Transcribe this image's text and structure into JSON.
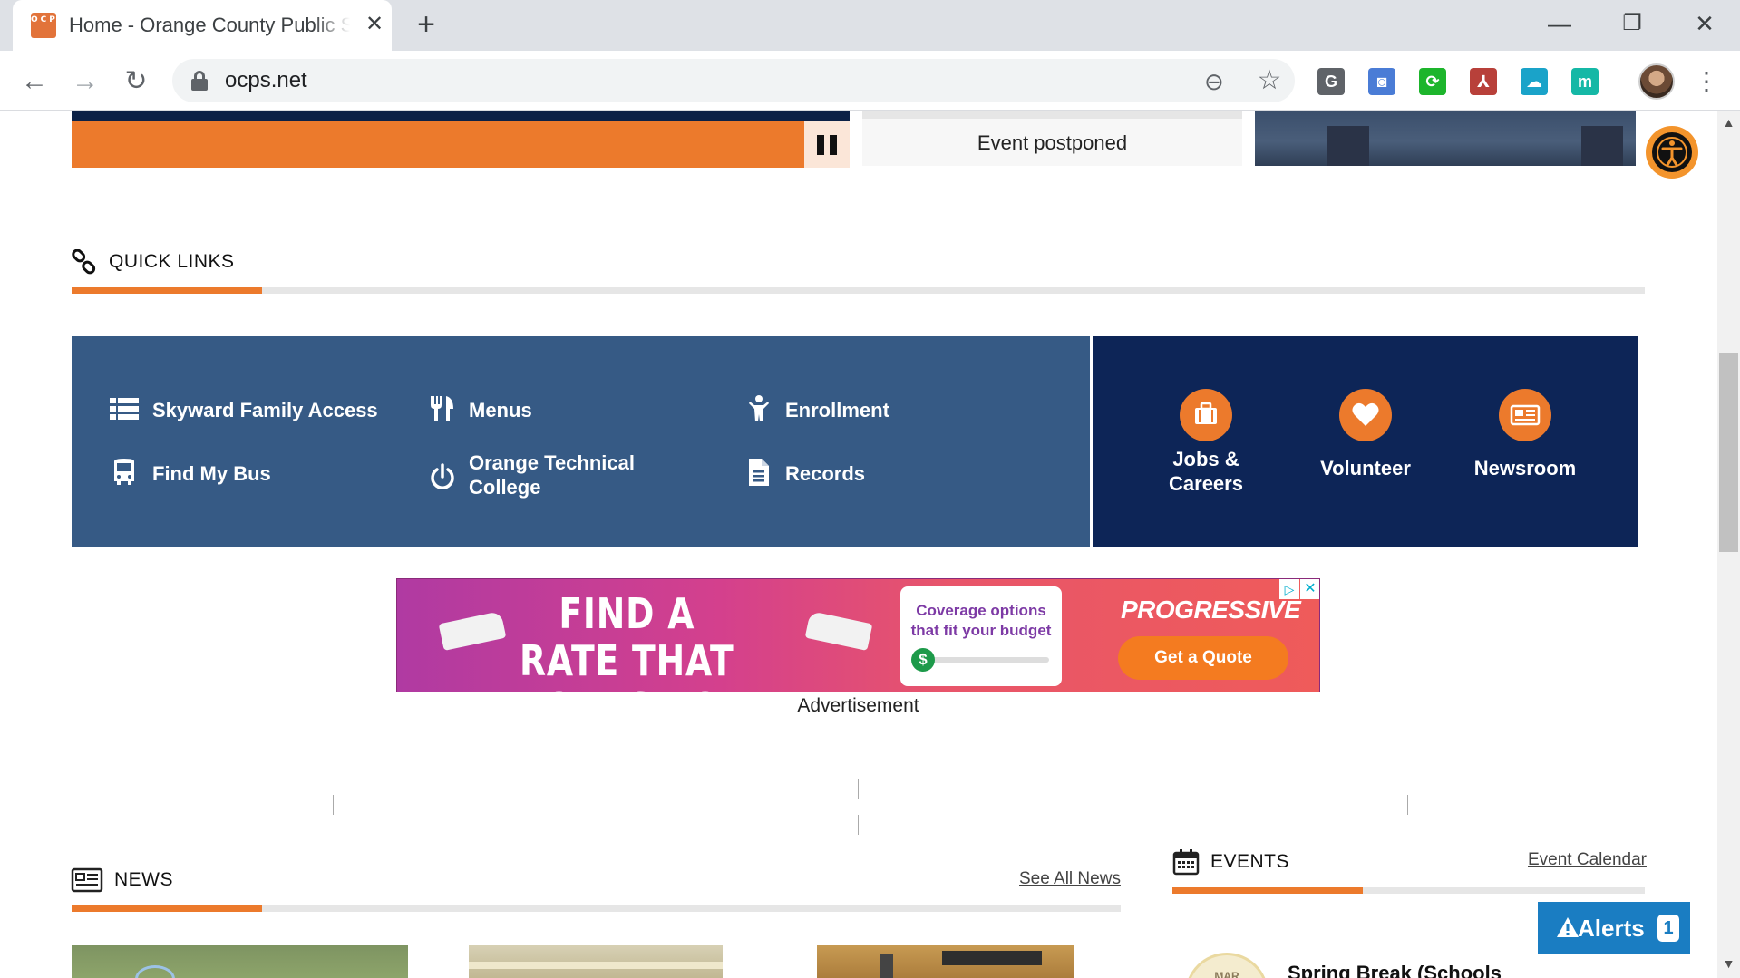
{
  "browser": {
    "tab_title": "Home - Orange County Public Schools",
    "favicon_text": "OCPS",
    "url": "ocps.net",
    "new_tab_symbol": "+",
    "tab_close_symbol": "✕",
    "back_symbol": "←",
    "forward_symbol": "→",
    "reload_symbol": "↻",
    "zoom_symbol": "⊖",
    "star_symbol": "☆",
    "minimize_symbol": "—",
    "restore_symbol": "❐",
    "window_close_symbol": "✕",
    "menu_symbol": "⋮",
    "extensions": [
      {
        "name": "grammarly-extension-icon",
        "glyph": "G",
        "color": "#5f6368"
      },
      {
        "name": "camera-extension-icon",
        "glyph": "◙",
        "color": "#4a7cd6"
      },
      {
        "name": "sync-extension-icon",
        "glyph": "⟳",
        "color": "#1db52c"
      },
      {
        "name": "pdf-extension-icon",
        "glyph": "⅄",
        "color": "#b8403a"
      },
      {
        "name": "vpn-extension-icon",
        "glyph": "☁",
        "color": "#1aa3c9"
      },
      {
        "name": "m-extension-icon",
        "glyph": "m",
        "color": "#15b8a6"
      }
    ]
  },
  "hero": {
    "event_card_text": "Event postponed"
  },
  "quick_links": {
    "title": "QUICK LINKS",
    "left_items": [
      {
        "label": "Skyward Family Access",
        "icon": "list-icon"
      },
      {
        "label": "Menus",
        "icon": "utensils-icon"
      },
      {
        "label": "Enrollment",
        "icon": "person-icon"
      },
      {
        "label": "Find My Bus",
        "icon": "bus-icon"
      },
      {
        "label": "Orange Technical College",
        "icon": "power-icon"
      },
      {
        "label": "Records",
        "icon": "document-icon"
      }
    ],
    "right_items": [
      {
        "label": "Jobs & Careers",
        "icon": "briefcase-icon"
      },
      {
        "label": "Volunteer",
        "icon": "heart-icon"
      },
      {
        "label": "Newsroom",
        "icon": "newspaper-icon"
      }
    ]
  },
  "ad": {
    "headline": "FIND A RATE THAT WORKS FOR YOU",
    "card_copy": "Coverage options that fit your budget",
    "card_knob": "$",
    "brand": "PROGRESSIVE",
    "cta": "Get a Quote",
    "adchoices_symbol": "▷",
    "close_symbol": "✕",
    "label": "Advertisement"
  },
  "news": {
    "title": "NEWS",
    "see_all": "See All News"
  },
  "events": {
    "title": "EVENTS",
    "calendar_link": "Event Calendar",
    "badge_text": "MAR",
    "first_event": "Spring Break (Schools"
  },
  "alerts": {
    "label": "Alerts",
    "count": "1"
  },
  "colors": {
    "brand_orange": "#ec7a2c",
    "brand_navy": "#0d2557",
    "quicklinks_blue": "#365a85",
    "alerts_blue": "#1a7dc2"
  }
}
